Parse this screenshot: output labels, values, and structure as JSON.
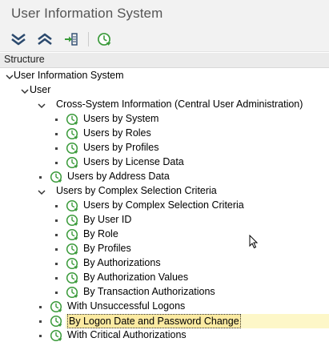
{
  "window": {
    "title": "User Information System"
  },
  "toolbar": {
    "buttons": [
      {
        "name": "collapse-all",
        "icon": "double-chevron-down-icon"
      },
      {
        "name": "expand-all",
        "icon": "double-chevron-up-icon"
      },
      {
        "name": "open-subtree",
        "icon": "subtree-arrow-icon"
      },
      {
        "name": "execute",
        "icon": "execute-clock-icon"
      }
    ]
  },
  "structure": {
    "header": "Structure",
    "nodes": [
      {
        "label": "User Information System",
        "level": 0,
        "type": "folder",
        "expanded": true
      },
      {
        "label": "User",
        "level": 1,
        "type": "folder",
        "expanded": true
      },
      {
        "label": "Cross-System Information (Central User Administration)",
        "level": 2,
        "type": "folder",
        "expanded": true
      },
      {
        "label": "Users by System",
        "level": 3,
        "type": "report"
      },
      {
        "label": "Users by Roles",
        "level": 3,
        "type": "report"
      },
      {
        "label": "Users by Profiles",
        "level": 3,
        "type": "report"
      },
      {
        "label": "Users by License Data",
        "level": 3,
        "type": "report"
      },
      {
        "label": "Users by Address Data",
        "level": 2,
        "type": "report"
      },
      {
        "label": "Users by Complex Selection Criteria",
        "level": 2,
        "type": "folder",
        "expanded": true
      },
      {
        "label": "Users by Complex Selection Criteria",
        "level": 3,
        "type": "report"
      },
      {
        "label": "By User ID",
        "level": 3,
        "type": "report"
      },
      {
        "label": "By Role",
        "level": 3,
        "type": "report"
      },
      {
        "label": "By Profiles",
        "level": 3,
        "type": "report"
      },
      {
        "label": "By Authorizations",
        "level": 3,
        "type": "report"
      },
      {
        "label": "By Authorization Values",
        "level": 3,
        "type": "report"
      },
      {
        "label": "By Transaction Authorizations",
        "level": 3,
        "type": "report"
      },
      {
        "label": "With Unsuccessful Logons",
        "level": 2,
        "type": "report"
      },
      {
        "label": "By Logon Date and Password Change",
        "level": 2,
        "type": "report",
        "selected": true
      },
      {
        "label": "With Critical Authorizations",
        "level": 2,
        "type": "report"
      }
    ]
  },
  "colors": {
    "icon_green": "#3a9a3a",
    "selection_fill": "#fdf7c8",
    "title_color": "#555555"
  }
}
